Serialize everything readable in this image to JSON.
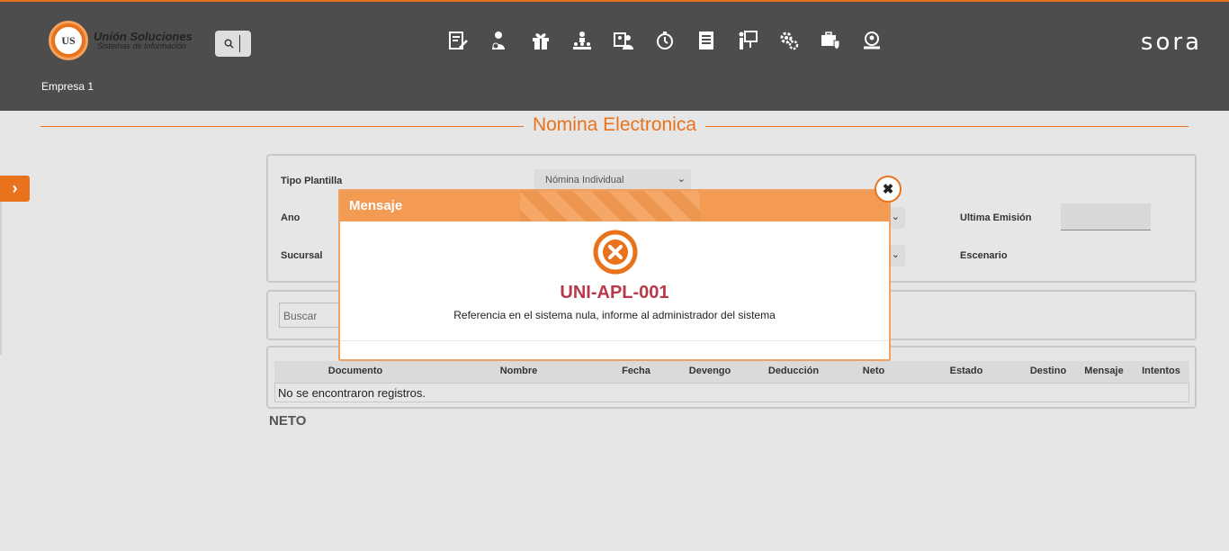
{
  "header": {
    "logo_badge": "UNION US",
    "logo_title": "Unión Soluciones",
    "logo_subtitle": "Sistemas de Información",
    "brand": "sora",
    "company": "Empresa 1",
    "nav_icons": [
      "edit-document-icon",
      "user-money-icon",
      "gift-icon",
      "org-chart-icon",
      "contacts-icon",
      "stopwatch-icon",
      "document-icon",
      "presentation-icon",
      "settings-gears-icon",
      "shield-briefcase-icon",
      "security-users-icon"
    ]
  },
  "page": {
    "title": "Nomina Electronica"
  },
  "filters": {
    "tipo_label": "Tipo Plantilla",
    "tipo_value": "Nómina Individual",
    "ano_label": "Ano",
    "sucursal_label": "Sucursal",
    "ultima_label": "Ultima Emisión",
    "escenario_label": "Escenario"
  },
  "search": {
    "placeholder": "Buscar"
  },
  "table": {
    "columns": [
      "Documento",
      "Nombre",
      "Fecha",
      "Devengo",
      "Deducción",
      "Neto",
      "Estado",
      "Destino",
      "Mensaje",
      "Intentos"
    ],
    "empty_text": "No se encontraron registros."
  },
  "summary": {
    "neto_label": "NETO"
  },
  "modal": {
    "title": "Mensaje",
    "code": "UNI-APL-001",
    "message": "Referencia en el sistema nula, informe al administrador del sistema",
    "close_symbol": "✖"
  },
  "colors": {
    "accent": "#e8731c",
    "header_bg": "#4d4d4d",
    "error_code": "#b83a4a",
    "modal_header": "#f49b53"
  }
}
